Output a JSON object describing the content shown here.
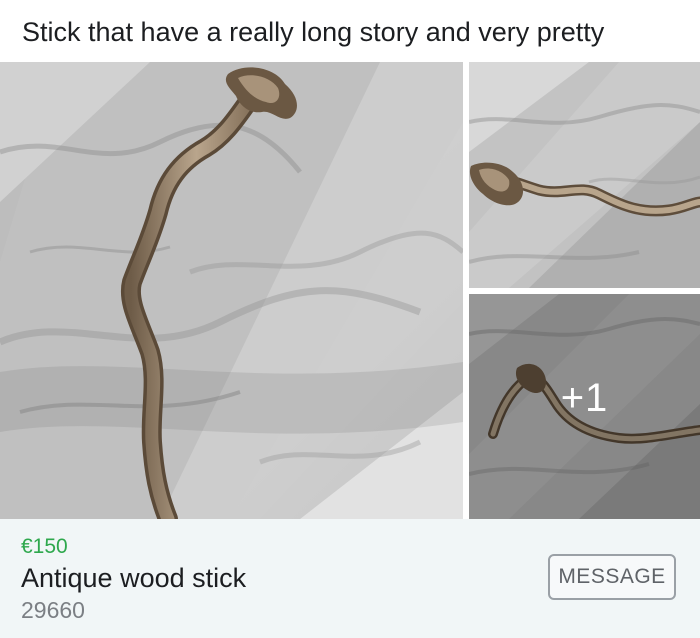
{
  "post": {
    "text": "Stick that have a really long story and very pretty"
  },
  "gallery": {
    "more_count": "+1",
    "photos": [
      {
        "subject": "wooden stick on marble floor"
      },
      {
        "subject": "wooden stick on marble floor"
      },
      {
        "subject": "wooden stick on marble floor"
      }
    ]
  },
  "listing": {
    "price": "€150",
    "title": "Antique wood stick",
    "location": "29660",
    "message_button": "MESSAGE"
  },
  "colors": {
    "price": "#2ea84d",
    "listing_background": "#f1f6f7",
    "title": "#1c1e21",
    "location": "#7b7f84",
    "button_border": "#9aa0a6"
  }
}
